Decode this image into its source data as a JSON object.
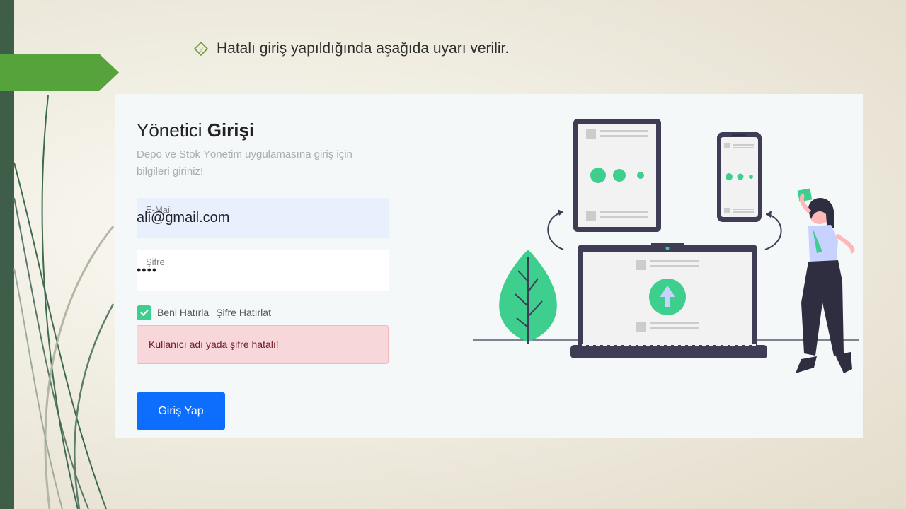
{
  "slide": {
    "bullet_icon": "diamond-question-icon",
    "heading": "Hatalı giriş yapıldığında aşağıda uyarı verilir."
  },
  "login": {
    "title_regular": "Yönetici ",
    "title_bold": "Girişi",
    "subtitle": "Depo ve Stok Yönetim uygulamasına giriş için bilgileri giriniz!",
    "email": {
      "label": "E-Mail",
      "value": "ali@gmail.com"
    },
    "password": {
      "label": "Şifre",
      "value": "••••"
    },
    "remember_label": "Beni Hatırla",
    "forgot_link": "Şifre Hatırlat",
    "remember_checked": true,
    "error_message": "Kullanıcı adı yada şifre hatalı!",
    "submit_label": "Giriş Yap"
  },
  "colors": {
    "accent_green": "#3ecf8e",
    "button_blue": "#0d6efd",
    "alert_bg": "#f8d7da",
    "alert_text": "#721c24",
    "slide_dark_green": "#3e5e4a",
    "slide_arrow_green": "#55a33a"
  }
}
